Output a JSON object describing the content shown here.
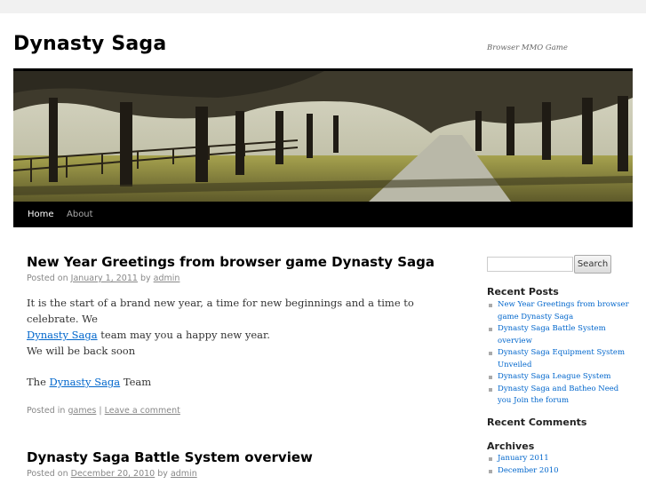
{
  "site": {
    "title": "Dynasty Saga",
    "description": "Browser MMO Game"
  },
  "menu": {
    "items": [
      "Home",
      "About"
    ]
  },
  "posts": [
    {
      "title": "New Year Greetings from browser game Dynasty Saga",
      "posted_on": "Posted on",
      "date": "January 1, 2011",
      "by": "by",
      "author": "admin",
      "p1_a": "It is the start of a brand new year, a time for new beginnings and a time to celebrate. We",
      "p1_link": "Dynasty Saga",
      "p1_b": "team may you a happy new year.",
      "p2": "We will be back soon",
      "p3_a": "The",
      "p3_link": "Dynasty Saga",
      "p3_b": "Team",
      "posted_in": "Posted in",
      "category": "games",
      "separator": "|",
      "comment_link": "Leave a comment"
    },
    {
      "title": "Dynasty Saga Battle System overview",
      "posted_on": "Posted on",
      "date": "December 20, 2010",
      "by": "by",
      "author": "admin"
    }
  ],
  "sidebar": {
    "search_button": "Search",
    "search_value": "",
    "recent_posts_title": "Recent Posts",
    "recent_posts": [
      "New Year Greetings from browser game Dynasty Saga",
      "Dynasty Saga Battle System overview",
      "Dynasty Saga Equipment System Unveiled",
      "Dynasty Saga League System",
      "Dynasty Saga and Batheo Need you Join the forum"
    ],
    "recent_comments_title": "Recent Comments",
    "archives_title": "Archives",
    "archives": [
      "January 2011",
      "December 2010"
    ]
  },
  "colors": {
    "link": "#0066cc",
    "menu_bg": "#000000",
    "page_bg": "#f1f1f1"
  }
}
